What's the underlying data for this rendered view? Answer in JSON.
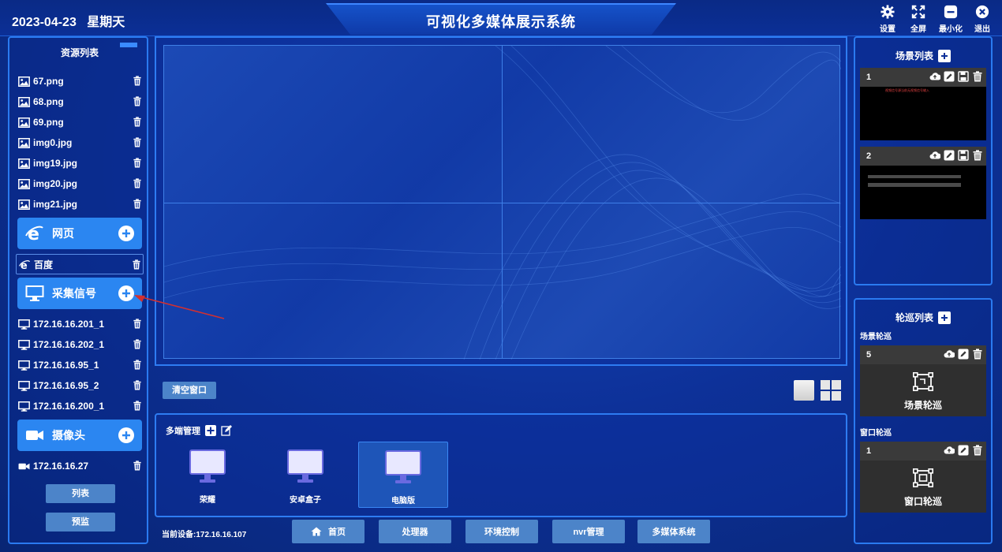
{
  "header": {
    "date": "2023-04-23",
    "weekday": "星期天",
    "title": "可视化多媒体展示系统",
    "actions": [
      {
        "icon": "gear-icon",
        "label": "设置"
      },
      {
        "icon": "fullscreen-icon",
        "label": "全屏"
      },
      {
        "icon": "minimize-icon",
        "label": "最小化"
      },
      {
        "icon": "close-icon",
        "label": "退出"
      }
    ]
  },
  "resources": {
    "title": "资源列表",
    "images": [
      "67.png",
      "68.png",
      "69.png",
      "img0.jpg",
      "img19.jpg",
      "img20.jpg",
      "img21.jpg"
    ],
    "web_category": "网页",
    "web_items": [
      "百度"
    ],
    "capture_category": "采集信号",
    "capture_items": [
      "172.16.16.201_1",
      "172.16.16.202_1",
      "172.16.16.95_1",
      "172.16.16.95_2",
      "172.16.16.200_1"
    ],
    "camera_category": "摄像头",
    "camera_items": [
      "172.16.16.27"
    ],
    "list_button": "列表",
    "preview_button": "预监"
  },
  "canvas": {
    "clear_button": "清空窗口"
  },
  "multi": {
    "title": "多端管理",
    "terminals": [
      {
        "label": "荣耀",
        "active": false
      },
      {
        "label": "安卓盒子",
        "active": false
      },
      {
        "label": "电脑版",
        "active": true
      }
    ]
  },
  "status": {
    "current_device": "当前设备:172.16.16.107"
  },
  "nav": {
    "home": "首页",
    "processor": "处理器",
    "env": "环境控制",
    "nvr": "nvr管理",
    "multimedia": "多媒体系统"
  },
  "scenes": {
    "title": "场景列表",
    "items": [
      {
        "id": "1",
        "preview_text": "视频信号源当前无视频信号输入"
      },
      {
        "id": "2",
        "preview_text": ""
      }
    ]
  },
  "tours": {
    "title": "轮巡列表",
    "scene_section": "场景轮巡",
    "scene_items": [
      {
        "id": "5",
        "label": "场景轮巡"
      }
    ],
    "window_section": "窗口轮巡",
    "window_items": [
      {
        "id": "1",
        "label": "窗口轮巡"
      }
    ]
  },
  "colors": {
    "accent": "#2b86f1",
    "button": "#4c84c9",
    "background": "#0b2a8f"
  }
}
